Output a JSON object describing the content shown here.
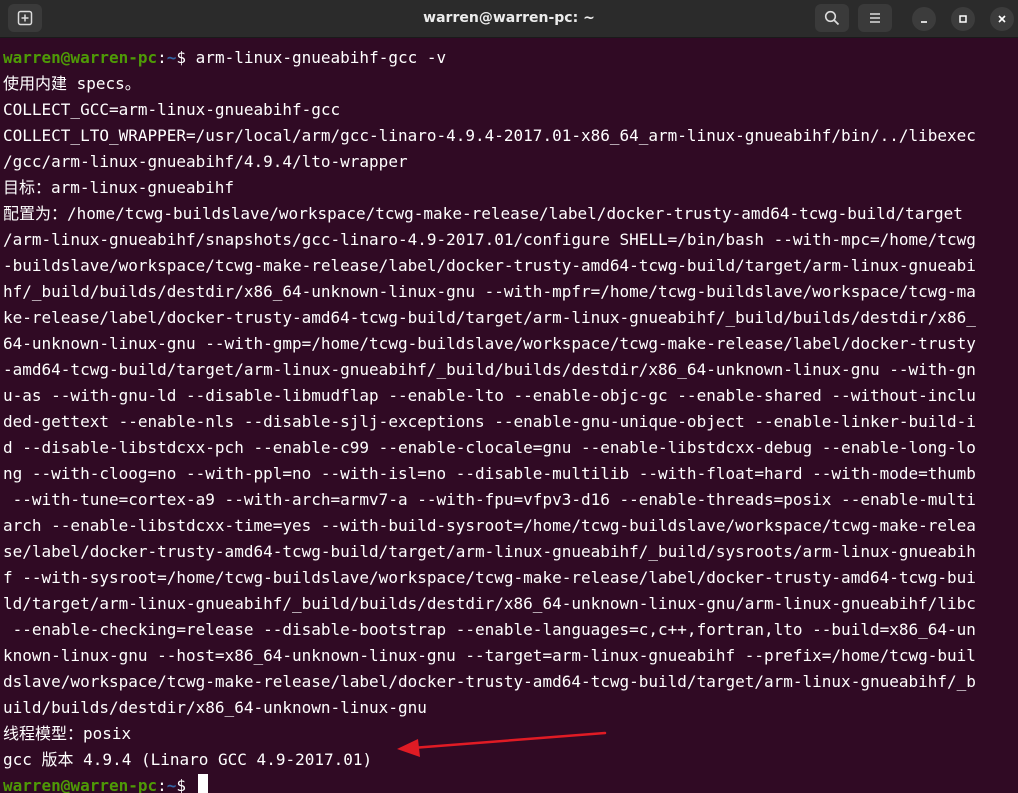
{
  "window": {
    "title": "warren@warren-pc: ~"
  },
  "icons": {
    "new_tab": "new-tab-icon",
    "search": "search-icon",
    "menu": "hamburger-menu-icon",
    "minimize": "minimize-icon",
    "maximize": "maximize-icon",
    "close": "close-icon"
  },
  "colors": {
    "background": "#300a24",
    "prompt_user": "#4e9a06",
    "prompt_path": "#3465a4",
    "annotation_arrow": "#e01b24"
  },
  "prompt": {
    "user_host": "warren@warren-pc",
    "separator": ":",
    "path": "~",
    "symbol": "$ "
  },
  "command": "arm-linux-gnueabihf-gcc -v",
  "output": [
    "使用内建 specs。",
    "COLLECT_GCC=arm-linux-gnueabihf-gcc",
    "COLLECT_LTO_WRAPPER=/usr/local/arm/gcc-linaro-4.9.4-2017.01-x86_64_arm-linux-gnueabihf/bin/../libexec",
    "/gcc/arm-linux-gnueabihf/4.9.4/lto-wrapper",
    "目标：arm-linux-gnueabihf",
    "配置为：/home/tcwg-buildslave/workspace/tcwg-make-release/label/docker-trusty-amd64-tcwg-build/target",
    "/arm-linux-gnueabihf/snapshots/gcc-linaro-4.9-2017.01/configure SHELL=/bin/bash --with-mpc=/home/tcwg",
    "-buildslave/workspace/tcwg-make-release/label/docker-trusty-amd64-tcwg-build/target/arm-linux-gnueabi",
    "hf/_build/builds/destdir/x86_64-unknown-linux-gnu --with-mpfr=/home/tcwg-buildslave/workspace/tcwg-ma",
    "ke-release/label/docker-trusty-amd64-tcwg-build/target/arm-linux-gnueabihf/_build/builds/destdir/x86_",
    "64-unknown-linux-gnu --with-gmp=/home/tcwg-buildslave/workspace/tcwg-make-release/label/docker-trusty",
    "-amd64-tcwg-build/target/arm-linux-gnueabihf/_build/builds/destdir/x86_64-unknown-linux-gnu --with-gn",
    "u-as --with-gnu-ld --disable-libmudflap --enable-lto --enable-objc-gc --enable-shared --without-inclu",
    "ded-gettext --enable-nls --disable-sjlj-exceptions --enable-gnu-unique-object --enable-linker-build-i",
    "d --disable-libstdcxx-pch --enable-c99 --enable-clocale=gnu --enable-libstdcxx-debug --enable-long-lo",
    "ng --with-cloog=no --with-ppl=no --with-isl=no --disable-multilib --with-float=hard --with-mode=thumb",
    " --with-tune=cortex-a9 --with-arch=armv7-a --with-fpu=vfpv3-d16 --enable-threads=posix --enable-multi",
    "arch --enable-libstdcxx-time=yes --with-build-sysroot=/home/tcwg-buildslave/workspace/tcwg-make-relea",
    "se/label/docker-trusty-amd64-tcwg-build/target/arm-linux-gnueabihf/_build/sysroots/arm-linux-gnueabih",
    "f --with-sysroot=/home/tcwg-buildslave/workspace/tcwg-make-release/label/docker-trusty-amd64-tcwg-bui",
    "ld/target/arm-linux-gnueabihf/_build/builds/destdir/x86_64-unknown-linux-gnu/arm-linux-gnueabihf/libc",
    " --enable-checking=release --disable-bootstrap --enable-languages=c,c++,fortran,lto --build=x86_64-un",
    "known-linux-gnu --host=x86_64-unknown-linux-gnu --target=arm-linux-gnueabihf --prefix=/home/tcwg-buil",
    "dslave/workspace/tcwg-make-release/label/docker-trusty-amd64-tcwg-build/target/arm-linux-gnueabihf/_b",
    "uild/builds/destdir/x86_64-unknown-linux-gnu",
    "线程模型：posix",
    "gcc 版本 4.9.4 (Linaro GCC 4.9-2017.01)"
  ]
}
